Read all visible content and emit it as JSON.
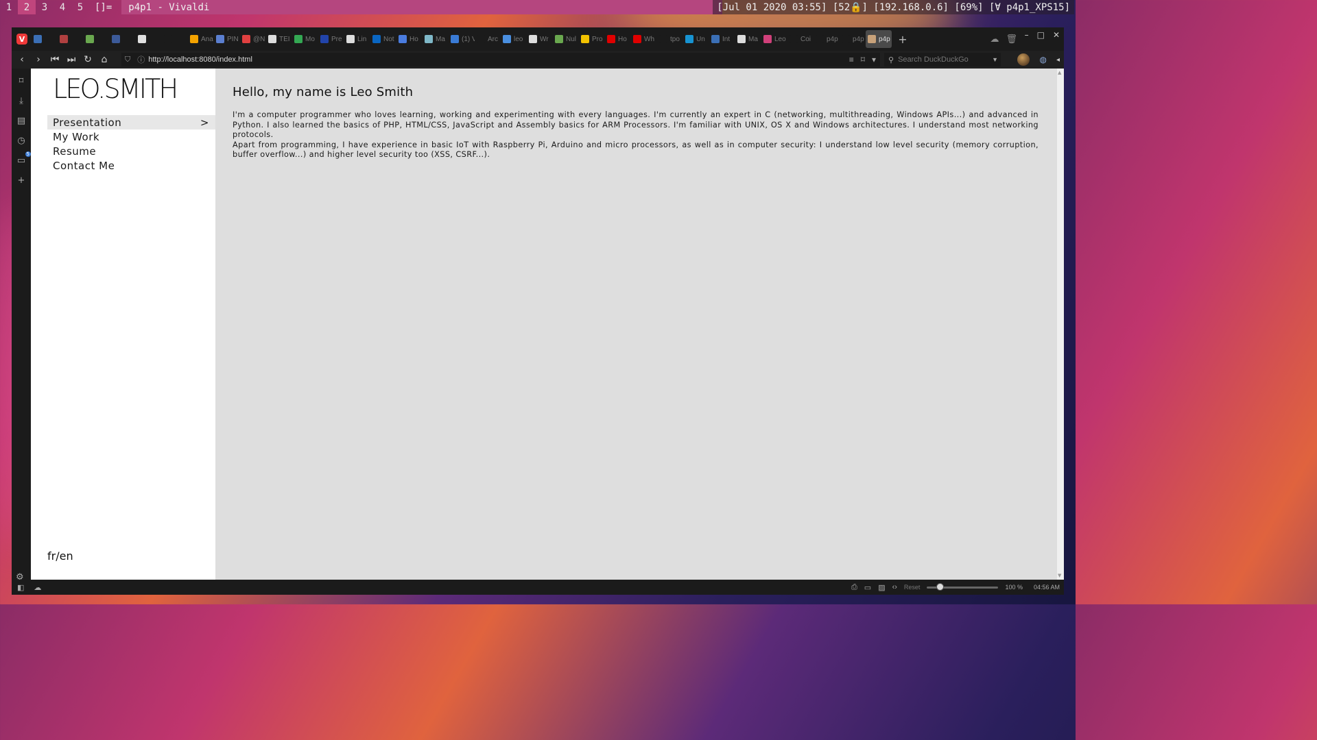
{
  "colors": {
    "i3_active_ws": "#c0457d",
    "browser_chrome": "#1b1b1b",
    "page_bg": "#dedede",
    "nav_bg": "#ffffff",
    "active_menu_bg": "#e7e7e7",
    "vivaldi_red": "#ef3939"
  },
  "i3bar": {
    "workspaces": [
      "1",
      "2",
      "3",
      "4",
      "5"
    ],
    "active_workspace": "2",
    "layout": "[]=",
    "window_title": "p4p1 - Vivaldi",
    "status": "[Jul 01 2020 03:55] [52🔒] [192.168.0.6] [69%] [Ɐ p4p1_XPS15]"
  },
  "browser": {
    "tabs": [
      {
        "label": "",
        "icon": "calendar-icon",
        "color": "#3b6fb5"
      },
      {
        "label": "",
        "icon": "gamepad-icon",
        "color": "#b04040"
      },
      {
        "label": "",
        "icon": "chip-icon",
        "color": "#6aa84f"
      },
      {
        "label": "",
        "icon": "globe-icon",
        "color": "#3c5a99"
      },
      {
        "label": "",
        "icon": "chat-icon",
        "color": "#e0e0e0"
      },
      {
        "label": "",
        "icon": "blank-icon",
        "color": "#1b1b1b"
      },
      {
        "label": "Ana",
        "icon": "analytics-icon",
        "color": "#f4a300"
      },
      {
        "label": "PIN",
        "icon": "diamond-icon",
        "color": "#5b7fd0"
      },
      {
        "label": "@N",
        "icon": "app-icon",
        "color": "#e04040"
      },
      {
        "label": "TEI",
        "icon": "document-icon",
        "color": "#dddddd"
      },
      {
        "label": "Mo",
        "icon": "drive-icon",
        "color": "#34a853"
      },
      {
        "label": "Pre",
        "icon": "bracket-icon",
        "color": "#2244aa"
      },
      {
        "label": "Lin",
        "icon": "document-icon",
        "color": "#dddddd"
      },
      {
        "label": "Not",
        "icon": "linkedin-icon",
        "color": "#0a66c2"
      },
      {
        "label": "Ho",
        "icon": "circle-c-icon",
        "color": "#4a7cdf"
      },
      {
        "label": "Ma",
        "icon": "bird-icon",
        "color": "#7fb8c8"
      },
      {
        "label": "(1) V",
        "icon": "mail-icon",
        "color": "#3a7bd5"
      },
      {
        "label": "Arc",
        "icon": "blank-icon",
        "color": "#1b1b1b"
      },
      {
        "label": "leo",
        "icon": "vivaldi-v-icon",
        "color": "#4a8fe0"
      },
      {
        "label": "Wr",
        "icon": "document-icon",
        "color": "#dddddd"
      },
      {
        "label": "Nul",
        "icon": "tree-icon",
        "color": "#6aa84f"
      },
      {
        "label": "Pro",
        "icon": "w-icon",
        "color": "#f2c200"
      },
      {
        "label": "Ho",
        "icon": "youtube-icon",
        "color": "#e00000"
      },
      {
        "label": "Wh",
        "icon": "youtube-icon",
        "color": "#e00000"
      },
      {
        "label": "tpo",
        "icon": "blank-icon",
        "color": "#1b1b1b"
      },
      {
        "label": "Un",
        "icon": "arch-icon",
        "color": "#1793d1"
      },
      {
        "label": "Int",
        "icon": "server-icon",
        "color": "#3b6fb5"
      },
      {
        "label": "Ma",
        "icon": "o-icon",
        "color": "#dddddd"
      },
      {
        "label": "Leo",
        "icon": "heart-icon",
        "color": "#d0407a"
      },
      {
        "label": "Coi",
        "icon": "blank-icon",
        "color": "#1b1b1b"
      },
      {
        "label": "p4p",
        "icon": "blank-icon",
        "color": "#1b1b1b"
      },
      {
        "label": "p4p",
        "icon": "blank-icon",
        "color": "#1b1b1b"
      },
      {
        "label": "p4p",
        "icon": "photo-icon",
        "color": "#c8a27a"
      }
    ],
    "active_tab_index": 32,
    "url": "http://localhost:8080/index.html",
    "search_placeholder": "Search DuckDuckGo",
    "status_reset": "Reset",
    "zoom": "100 %",
    "clock": "04:56 AM",
    "zoom_level": 0.15,
    "panel_badge": "5"
  },
  "site": {
    "logo": "LEO.SMITH",
    "menu": [
      {
        "label": "Presentation",
        "active": true,
        "arrow": ">"
      },
      {
        "label": "My Work",
        "active": false
      },
      {
        "label": "Resume",
        "active": false
      },
      {
        "label": "Contact Me",
        "active": false
      }
    ],
    "lang": "fr/en",
    "heading": "Hello, my name is Leo Smith",
    "paragraph1": "I'm a computer programmer who loves learning, working and experimenting with every languages. I'm currently an expert in C (networking, multithreading, Windows APIs...) and advanced in Python. I also learned the basics of PHP, HTML/CSS, JavaScript and Assembly basics for ARM Processors. I'm familiar with UNIX, OS X and Windows architectures. I understand most networking protocols.",
    "paragraph2": "Apart from programming, I have experience in basic IoT with Raspberry Pi, Arduino and micro processors, as well as in computer security: I understand low level security (memory corruption, buffer overflow...) and higher level security too (XSS, CSRF...)."
  }
}
